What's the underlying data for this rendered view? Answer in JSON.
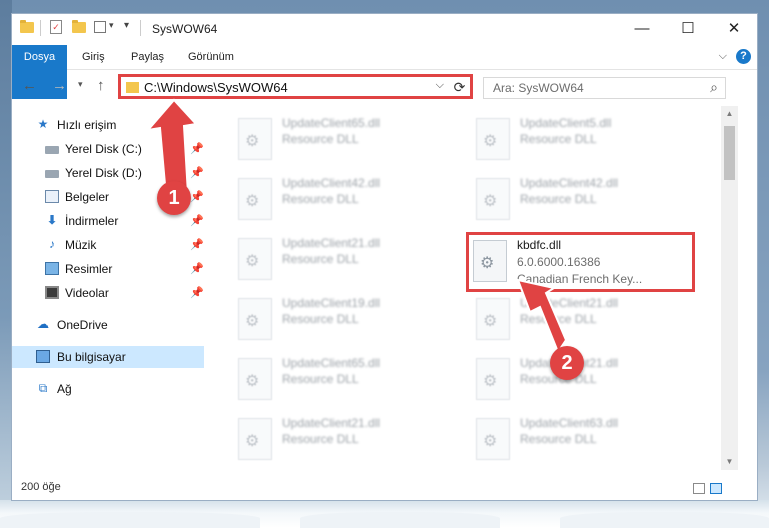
{
  "window": {
    "title": "SysWOW64",
    "controls": {
      "minimize": "—",
      "maximize": "☐",
      "close": "✕"
    }
  },
  "ribbon": {
    "tabs": [
      "Dosya",
      "Giriş",
      "Paylaş",
      "Görünüm"
    ],
    "help": "?"
  },
  "address": {
    "path": "C:\\Windows\\SysWOW64",
    "refresh_icon": "⟳",
    "dropdown_icon": "⌵"
  },
  "search": {
    "placeholder": "Ara: SysWOW64",
    "icon": "search-icon"
  },
  "nav": {
    "items": [
      {
        "label": "Hızlı erişim",
        "icon": "star-icon",
        "pinned": false
      },
      {
        "label": "Yerel Disk (C:)",
        "icon": "drive-icon",
        "pinned": true
      },
      {
        "label": "Yerel Disk (D:)",
        "icon": "drive-icon",
        "pinned": true
      },
      {
        "label": "Belgeler",
        "icon": "documents-icon",
        "pinned": true
      },
      {
        "label": "İndirmeler",
        "icon": "downloads-icon",
        "pinned": true
      },
      {
        "label": "Müzik",
        "icon": "music-icon",
        "pinned": true
      },
      {
        "label": "Resimler",
        "icon": "pictures-icon",
        "pinned": true
      },
      {
        "label": "Videolar",
        "icon": "videos-icon",
        "pinned": true
      },
      {
        "label": "OneDrive",
        "icon": "onedrive-icon",
        "pinned": false
      },
      {
        "label": "Bu bilgisayar",
        "icon": "this-pc-icon",
        "pinned": false,
        "selected": true
      },
      {
        "label": "Ağ",
        "icon": "network-icon",
        "pinned": false
      }
    ]
  },
  "files": [
    {
      "name": "UpdateClient65.dll",
      "desc": "Resource DLL",
      "blurred": true
    },
    {
      "name": "UpdateClient5.dll",
      "desc": "Resource DLL",
      "blurred": true
    },
    {
      "name": "UpdateClient42.dll",
      "desc": "Resource DLL",
      "blurred": true
    },
    {
      "name": "UpdateClient42.dll",
      "desc": "Resource DLL",
      "blurred": true
    },
    {
      "name": "UpdateClient21.dll",
      "desc": "Resource DLL",
      "blurred": true
    },
    {
      "name": "kbdfc.dll",
      "version": "6.0.6000.16386",
      "desc": "Canadian French Key...",
      "blurred": false,
      "highlighted": true
    },
    {
      "name": "UpdateClient19.dll",
      "desc": "Resource DLL",
      "blurred": true
    },
    {
      "name": "UpdateClient21.dll",
      "desc": "Resource DLL",
      "blurred": true
    },
    {
      "name": "UpdateClient65.dll",
      "desc": "Resource DLL",
      "blurred": true
    },
    {
      "name": "UpdateClient21.dll",
      "desc": "Resource DLL",
      "blurred": true
    },
    {
      "name": "UpdateClient21.dll",
      "desc": "Resource DLL",
      "blurred": true
    },
    {
      "name": "UpdateClient63.dll",
      "desc": "Resource DLL",
      "blurred": true
    }
  ],
  "status": {
    "count": "200 öğe"
  },
  "annotations": [
    {
      "number": "1",
      "color": "#e04343"
    },
    {
      "number": "2",
      "color": "#e04343"
    }
  ],
  "colors": {
    "accent": "#1979ca",
    "highlight": "#e04343",
    "selected_nav": "#cce8ff"
  }
}
